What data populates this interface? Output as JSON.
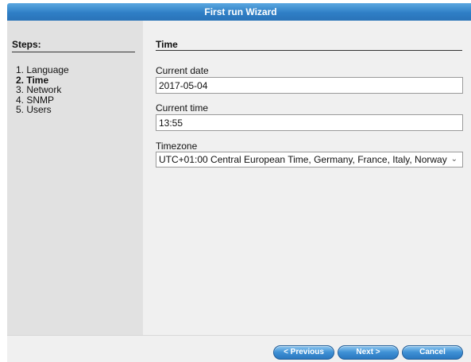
{
  "window": {
    "title": "First run Wizard"
  },
  "sidebar": {
    "heading": "Steps:",
    "steps": [
      {
        "label": "1. Language"
      },
      {
        "label": "2. Time",
        "current": true
      },
      {
        "label": "3. Network"
      },
      {
        "label": "4. SNMP"
      },
      {
        "label": "5. Users"
      }
    ]
  },
  "main": {
    "section_title": "Time",
    "current_date": {
      "label": "Current date",
      "value": "2017-05-04"
    },
    "current_time": {
      "label": "Current time",
      "value": "13:55"
    },
    "timezone": {
      "label": "Timezone",
      "selected": "UTC+01:00 Central European Time, Germany, France, Italy, Norway"
    }
  },
  "footer": {
    "previous_label": "< Previous",
    "next_label": "Next >",
    "cancel_label": "Cancel"
  },
  "colors": {
    "title_bar": "#2f7fc6",
    "sidebar_bg": "#e1e1e1",
    "content_bg": "#f0f0f0",
    "button": "#3d8fd4"
  }
}
